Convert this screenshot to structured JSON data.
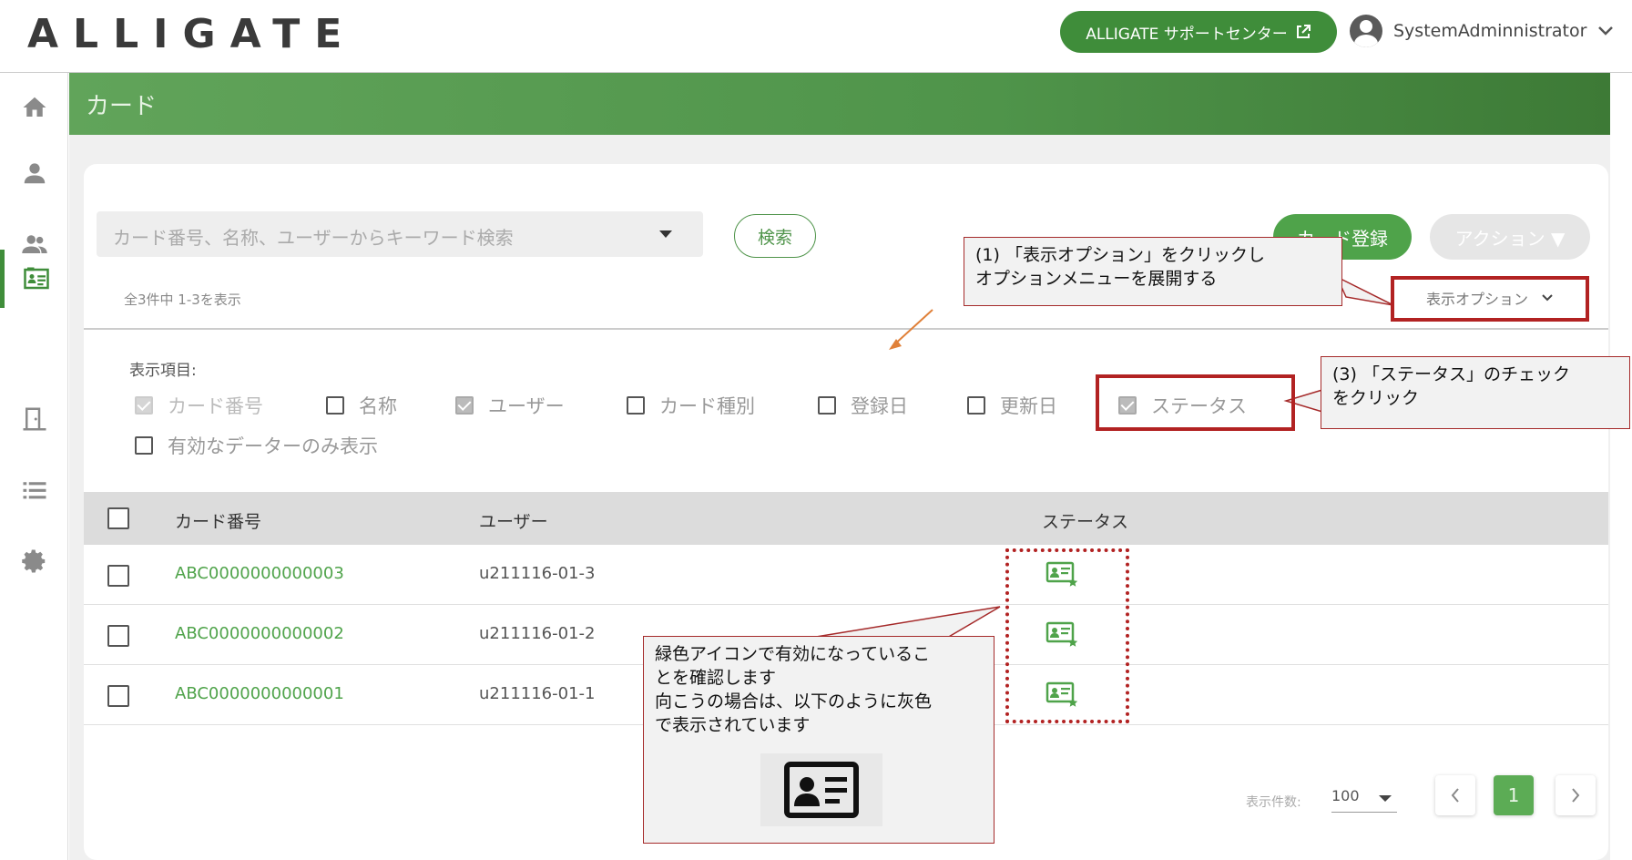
{
  "header": {
    "logo": "ALLIGATE",
    "support_label": "ALLIGATE サポートセンター",
    "user_name": "SystemAdminnistrator"
  },
  "page": {
    "title": "カード"
  },
  "sidebar": {
    "items": [
      {
        "icon": "home-icon",
        "active": false
      },
      {
        "icon": "person-icon",
        "active": false
      },
      {
        "icon": "group-icon",
        "active": false
      },
      {
        "icon": "card-icon",
        "active": true
      },
      {
        "icon": "door-icon",
        "active": false
      },
      {
        "icon": "list-icon",
        "active": false
      },
      {
        "icon": "gear-icon",
        "active": false
      }
    ]
  },
  "toolbar": {
    "search_placeholder": "カード番号、名称、ユーザーからキーワード検索",
    "search_button": "検索",
    "register_button": "カード登録",
    "action_button": "アクション ▼",
    "count_text": "全3件中 1-3を表示",
    "display_options": "表示オプション"
  },
  "options": {
    "label": "表示項目:",
    "items": [
      {
        "label": "カード番号",
        "checked": true,
        "disabled": true
      },
      {
        "label": "名称",
        "checked": false
      },
      {
        "label": "ユーザー",
        "checked": true
      },
      {
        "label": "カード種別",
        "checked": false
      },
      {
        "label": "登録日",
        "checked": false
      },
      {
        "label": "更新日",
        "checked": false
      },
      {
        "label": "ステータス",
        "checked": true
      },
      {
        "label": "有効なデーターのみ表示",
        "checked": false
      }
    ]
  },
  "table": {
    "headers": [
      "カード番号",
      "ユーザー",
      "ステータス"
    ],
    "rows": [
      {
        "card_no": "ABC0000000000003",
        "user": "u211116-01-3",
        "status": "active"
      },
      {
        "card_no": "ABC0000000000002",
        "user": "u211116-01-2",
        "status": "active"
      },
      {
        "card_no": "ABC0000000000001",
        "user": "u211116-01-1",
        "status": "active"
      }
    ]
  },
  "pagination": {
    "label": "表示件数:",
    "page_size": "100",
    "current_page": "1"
  },
  "annotations": {
    "step1_line1": "(1) 「表示オプション」をクリックし",
    "step1_line2": "オプションメニューを展開する",
    "step3_line1": "(3) 「ステータス」のチェック",
    "step3_line2": "をクリック",
    "note_line1": "緑色アイコンで有効になっているこ",
    "note_line2": "とを確認します",
    "note_line3": "向こうの場合は、以下のように灰色",
    "note_line4": "で表示されています"
  },
  "colors": {
    "brand_green": "#3f8d3a",
    "link_green": "#4fa34a",
    "annotation_red": "#b22222"
  }
}
